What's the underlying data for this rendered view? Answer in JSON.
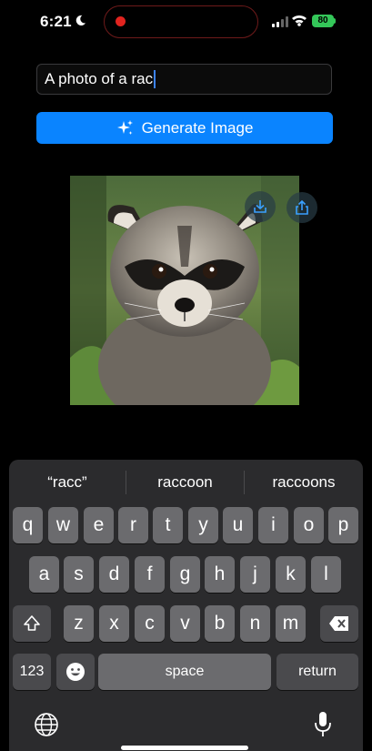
{
  "status": {
    "time": "6:21",
    "battery": "80"
  },
  "prompt": {
    "value": "A photo of a rac"
  },
  "generate": {
    "label": "Generate Image"
  },
  "suggestions": [
    "“racc”",
    "raccoon",
    "raccoons"
  ],
  "keys": {
    "row1": [
      "q",
      "w",
      "e",
      "r",
      "t",
      "y",
      "u",
      "i",
      "o",
      "p"
    ],
    "row2": [
      "a",
      "s",
      "d",
      "f",
      "g",
      "h",
      "j",
      "k",
      "l"
    ],
    "row3": [
      "z",
      "x",
      "c",
      "v",
      "b",
      "n",
      "m"
    ],
    "numbers": "123",
    "space": "space",
    "return": "return"
  },
  "icons": {
    "moon": "moon-icon",
    "record": "record-dot-icon",
    "sparkles": "sparkles-icon",
    "download": "download-icon",
    "share": "share-icon",
    "shift": "shift-icon",
    "delete": "delete-icon",
    "emoji": "emoji-icon",
    "globe": "globe-icon",
    "mic": "microphone-icon"
  },
  "colors": {
    "accent": "#0a84ff",
    "battery": "#34c759",
    "record": "#e2241f"
  }
}
